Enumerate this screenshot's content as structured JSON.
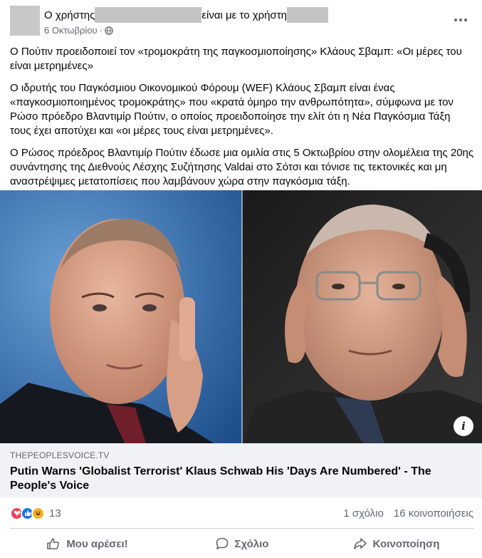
{
  "post": {
    "author_prefix": "Ο χρήστης",
    "author_middle": "είναι με το χρήστη",
    "date": "6 Οκτωβρίου",
    "date_separator": "·",
    "paragraphs": [
      "Ο Πούτιν προειδοποιεί τον «τρομοκράτη της παγκοσμιοποίησης» Κλάους Σβαμπ: «Οι μέρες του είναι μετρημένες»",
      "Ο ιδρυτής του Παγκόσμιου Οικονομικού Φόρουμ (WEF) Κλάους Σβαμπ είναι ένας «παγκοσμιοποιημένος τρομοκράτης» που «κρατά όμηρο την ανθρωπότητα», σύμφωνα με τον Ρώσο πρόεδρο Βλαντιμίρ Πούτιν, ο οποίος προειδοποίησε την ελίτ ότι η Νέα Παγκόσμια Τάξη τους έχει αποτύχει και «οι μέρες τους είναι μετρημένες».",
      "Ο Ρώσος πρόεδρος Βλαντιμίρ Πούτιν έδωσε μια ομιλία στις 5 Οκτωβρίου στην ολομέλεια της 20ης συνάντησης της Διεθνούς Λέσχης Συζήτησης Valdai στο Σότσι και τόνισε τις τεκτονικές και μη αναστρέψιμες μετατοπίσεις που λαμβάνουν χώρα στην παγκόσμια τάξη."
    ]
  },
  "image": {
    "info_label": "i"
  },
  "link": {
    "domain": "THEPEOPLESVOICE.TV",
    "title": "Putin Warns 'Globalist Terrorist' Klaus Schwab His 'Days Are Numbered' - The People's Voice"
  },
  "stats": {
    "reaction_count": "13",
    "comments": "1 σχόλιο",
    "shares": "16 κοινοποιήσεις"
  },
  "actions": {
    "like": "Μου αρέσει!",
    "comment": "Σχόλιο",
    "share": "Κοινοποίηση"
  },
  "icons": {
    "privacy": "globe-icon",
    "more": "more-options-icon",
    "info": "info-icon",
    "reactions": [
      "love-reaction-icon",
      "like-reaction-icon",
      "haha-reaction-icon"
    ],
    "actions": [
      "like-thumb-icon",
      "comment-bubble-icon",
      "share-arrow-icon"
    ]
  },
  "colors": {
    "accent": "#1877f2",
    "muted_text": "#65676b",
    "card_bg": "#f0f2f5"
  }
}
